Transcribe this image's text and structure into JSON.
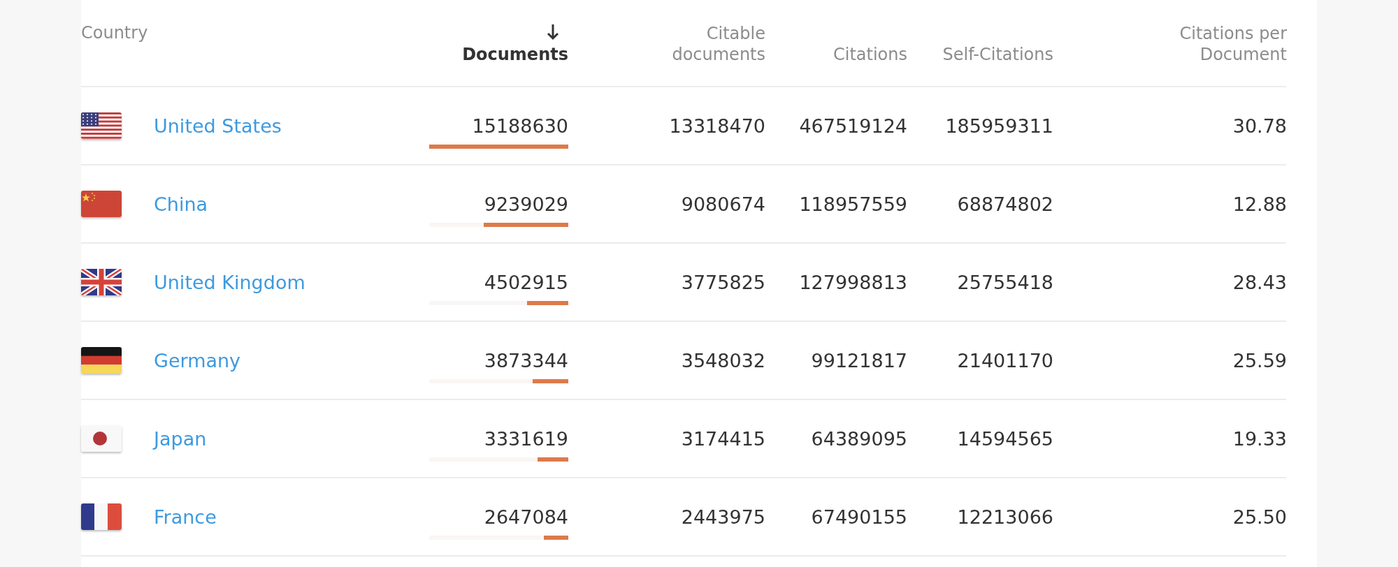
{
  "columns": [
    {
      "label": "Country",
      "sorted": false
    },
    {
      "label": "Documents",
      "sorted": true
    },
    {
      "label": "Citable documents",
      "sorted": false
    },
    {
      "label": "Citations",
      "sorted": false
    },
    {
      "label": "Self-Citations",
      "sorted": false
    },
    {
      "label": "Citations per Document",
      "sorted": false
    }
  ],
  "rows": [
    {
      "kind": "us",
      "country": "United States",
      "documents": "15188630",
      "level": 1,
      "citable": "13318470",
      "citations": "467519124",
      "self_citations": "185959311",
      "per_document": "30.78"
    },
    {
      "kind": "cn",
      "country": "China",
      "documents": "9239029",
      "level": 0.608,
      "citable": "9080674",
      "citations": "118957559",
      "self_citations": "68874802",
      "per_document": "12.88"
    },
    {
      "kind": "gb",
      "country": "United Kingdom",
      "documents": "4502915",
      "level": 0.296,
      "citable": "3775825",
      "citations": "127998813",
      "self_citations": "25755418",
      "per_document": "28.43"
    },
    {
      "kind": "de",
      "country": "Germany",
      "documents": "3873344",
      "level": 0.255,
      "citable": "3548032",
      "citations": "99121817",
      "self_citations": "21401170",
      "per_document": "25.59"
    },
    {
      "kind": "jp",
      "country": "Japan",
      "documents": "3331619",
      "level": 0.219,
      "citable": "3174415",
      "citations": "64389095",
      "self_citations": "14594565",
      "per_document": "19.33"
    },
    {
      "kind": "fr",
      "country": "France",
      "documents": "2647084",
      "level": 0.174,
      "citable": "2443975",
      "citations": "67490155",
      "self_citations": "12213066",
      "per_document": "25.50"
    }
  ]
}
